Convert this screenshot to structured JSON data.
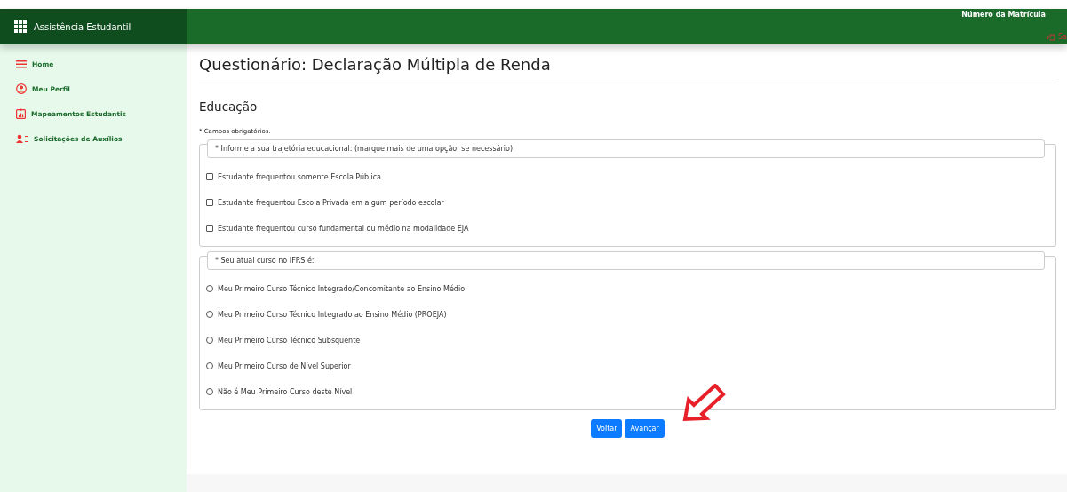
{
  "app": {
    "title": "Assistência Estudantil"
  },
  "header": {
    "enrollment_label": "Número da Matrícula",
    "logout": "Sa"
  },
  "sidebar": {
    "items": [
      {
        "label": "Home",
        "kind": "menu"
      },
      {
        "label": "Meu Perfil",
        "kind": "profile"
      },
      {
        "label": "Mapeamentos Estudantis",
        "kind": "chart"
      },
      {
        "label": "Solicitações de Auxílios",
        "kind": "users"
      }
    ]
  },
  "page": {
    "title": "Questionário: Declaração Múltipla de Renda",
    "section": "Educação",
    "required_note": "* Campos obrigatórios."
  },
  "groups": [
    {
      "legend": "* Informe a sua trajetória educacional: (marque mais de uma opção, se necessário)",
      "kind": "checkbox",
      "options": [
        {
          "label": "Estudante frequentou somente Escola Pública",
          "checked": false
        },
        {
          "label": "Estudante frequentou Escola Privada em algum período escolar",
          "checked": false
        },
        {
          "label": "Estudante frequentou curso fundamental ou médio na modalidade EJA",
          "checked": false
        }
      ]
    },
    {
      "legend": "* Seu atual curso no IFRS é:",
      "kind": "radio",
      "options": [
        {
          "label": "Meu Primeiro Curso Técnico Integrado/Concomitante ao Ensino Médio",
          "checked": false
        },
        {
          "label": "Meu Primeiro Curso Técnico Integrado ao Ensino Médio (PROEJA)",
          "checked": false
        },
        {
          "label": "Meu Primeiro Curso Técnico Subsquente",
          "checked": false
        },
        {
          "label": "Meu Primeiro Curso de Nível Superior",
          "checked": false
        },
        {
          "label": "Não é Meu Primeiro Curso deste Nível",
          "checked": false
        }
      ]
    }
  ],
  "buttons": [
    "Voltar",
    "Avançar"
  ]
}
